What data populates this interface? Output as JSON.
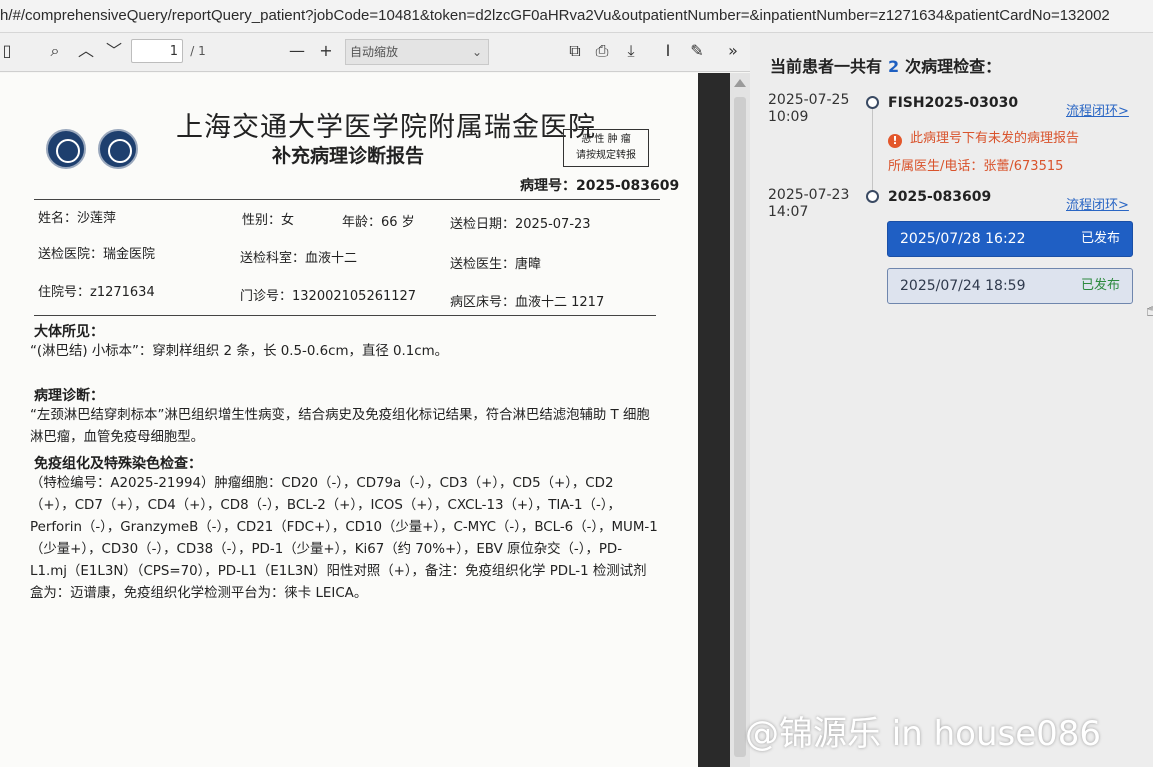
{
  "browser": {
    "url": "h/#/comprehensiveQuery/reportQuery_patient?jobCode=10481&token=d2lzcGF0aHRva2Vu&outpatientNumber=&inpatientNumber=z1271634&patientCardNo=132002"
  },
  "pdf_toolbar": {
    "page_current": "1",
    "page_total": "/ 1",
    "zoom_label": "自动缩放",
    "minus": "—",
    "plus": "+"
  },
  "report": {
    "hospital_name": "上海交通大学医学院附属瑞金医院",
    "report_title": "补充病理诊断报告",
    "stamp_line1": "恶 性 肿 瘤",
    "stamp_line2": "请按规定转报",
    "pathology_no": "病理号：2025-083609",
    "name": "姓名：沙莲萍",
    "sex": "性别：女",
    "age": "年龄：66 岁",
    "submit_date": "送检日期：2025-07-23",
    "submit_hospital": "送检医院：瑞金医院",
    "submit_dept": "送检科室：血液十二",
    "submit_doctor": "送检医生：唐暐",
    "inpatient_no": "住院号：z1271634",
    "outpatient_no": "门诊号：132002105261127",
    "ward_bed": "病区床号：血液十二 1217",
    "gross_title": "大体所见：",
    "gross_text": "“(淋巴结) 小标本”：穿刺样组织 2 条，长 0.5-0.6cm，直径 0.1cm。",
    "diag_title": "病理诊断：",
    "diag_text": "“左颈淋巴结穿刺标本”淋巴组织增生性病变，结合病史及免疫组化标记结果，符合淋巴结滤泡辅助 T 细胞淋巴瘤，血管免疫母细胞型。",
    "ihc_title": "免疫组化及特殊染色检查：",
    "ihc_text": "（特检编号：A2025-21994）肿瘤细胞：CD20（-），CD79a（-），CD3（+），CD5（+），CD2（+），CD7（+），CD4（+），CD8（-），BCL-2（+），ICOS（+），CXCL-13（+），TIA-1（-），Perforin（-），GranzymeB（-），CD21（FDC+），CD10（少量+），C-MYC（-），BCL-6（-），MUM-1（少量+），CD30（-），CD38（-），PD-1（少量+），Ki67（约 70%+），EBV 原位杂交（-），PD-L1.mj（E1L3N）（CPS=70），PD-L1（E1L3N）阳性对照（+），备注：免疫组织化学 PDL-1 检测试剂盒为：迈谱康，免疫组织化学检测平台为：徕卡 LEICA。"
  },
  "panel": {
    "heading_prefix": "当前患者一共有",
    "count": "2",
    "heading_suffix": "次病理检查：",
    "records": [
      {
        "date": "2025-07-25",
        "time": "10:09",
        "number": "FISH2025-03030",
        "link": "流程闭环>",
        "warning": "此病理号下有未发的病理报告",
        "doctor": "所属医生/电话：张蕾/673515"
      },
      {
        "date": "2025-07-23",
        "time": "14:07",
        "number": "2025-083609",
        "link": "流程闭环>",
        "reports": [
          {
            "time": "2025/07/28 16:22",
            "status": "已发布"
          },
          {
            "time": "2025/07/24 18:59",
            "status": "已发布"
          }
        ]
      }
    ]
  },
  "watermark": "@锦源乐 in house086",
  "colors": {
    "accent": "#1f5fc4",
    "warning": "#d9532c",
    "link": "#2a66c4"
  }
}
